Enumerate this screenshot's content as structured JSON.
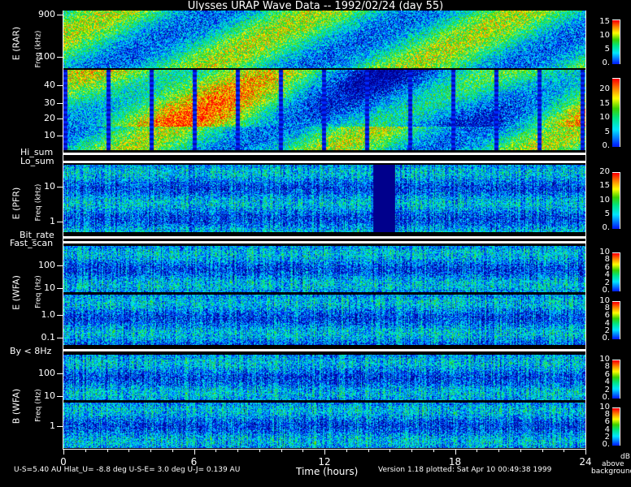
{
  "chart_data": {
    "type": "heatmap",
    "title": "Ulysses URAP Wave Data -- 1992/02/24  (day 55)",
    "xlabel": "Time (hours)",
    "xlim": [
      0,
      24
    ],
    "xticks": [
      "0",
      "6",
      "12",
      "18",
      "24"
    ],
    "colorbar_label": [
      "dB",
      "above",
      "background"
    ],
    "panels": [
      {
        "id": "rar-high",
        "instrument": "E (RAR)",
        "ylabel": "Freq (kHz)",
        "yticks": [
          "900",
          "100"
        ],
        "cbar": [
          "15",
          "10",
          "5",
          "0."
        ],
        "cmax": 16
      },
      {
        "id": "rar-low",
        "instrument": "",
        "ylabel": "",
        "yticks": [
          "40",
          "30",
          "20",
          "10"
        ],
        "cbar": [
          "20",
          "15",
          "10",
          "5",
          "0."
        ],
        "cmax": 24
      },
      {
        "id": "pfr",
        "instrument": "E (PFR)",
        "ylabel": "Freq (kHz)",
        "yticks": [
          "10",
          "1"
        ],
        "cbar": [
          "20",
          "15",
          "10",
          "5",
          "0."
        ],
        "cmax": 20
      },
      {
        "id": "wfa-e-high",
        "instrument": "E (WFA)",
        "ylabel": "Freq (Hz)",
        "yticks": [
          "100",
          "10"
        ],
        "cbar": [
          "10",
          "8",
          "6",
          "4",
          "2",
          "0."
        ],
        "cmax": 10
      },
      {
        "id": "wfa-e-low",
        "instrument": "",
        "ylabel": "",
        "yticks": [
          "1.0",
          "0.1"
        ],
        "cbar": [
          "10",
          "8",
          "6",
          "4",
          "2",
          "0."
        ],
        "cmax": 10
      },
      {
        "id": "wfa-b-high",
        "instrument": "B (WFA)",
        "ylabel": "Freq (Hz)",
        "yticks": [
          "100",
          "10"
        ],
        "cbar": [
          "10",
          "8",
          "6",
          "4",
          "2",
          "0."
        ],
        "cmax": 10
      },
      {
        "id": "wfa-b-low",
        "instrument": "",
        "ylabel": "",
        "yticks": [
          "1"
        ],
        "cbar": [
          "10",
          "8",
          "6",
          "4",
          "2",
          "0."
        ],
        "cmax": 10
      }
    ],
    "strips": {
      "hi_sum": "Hi_sum",
      "lo_sum": "Lo_sum",
      "bit_rate": "Bit_rate",
      "fast_scan": "Fast_scan",
      "by": "By < 8Hz"
    }
  },
  "footer": {
    "ephemeris": "U-S=5.40 AU  Hlat_U= -8.8 deg  U-S-E=  3.0 deg  U-J= 0.139 AU",
    "version": "Version 1.18 plotted: Sat Apr 10 00:49:38 1999"
  }
}
